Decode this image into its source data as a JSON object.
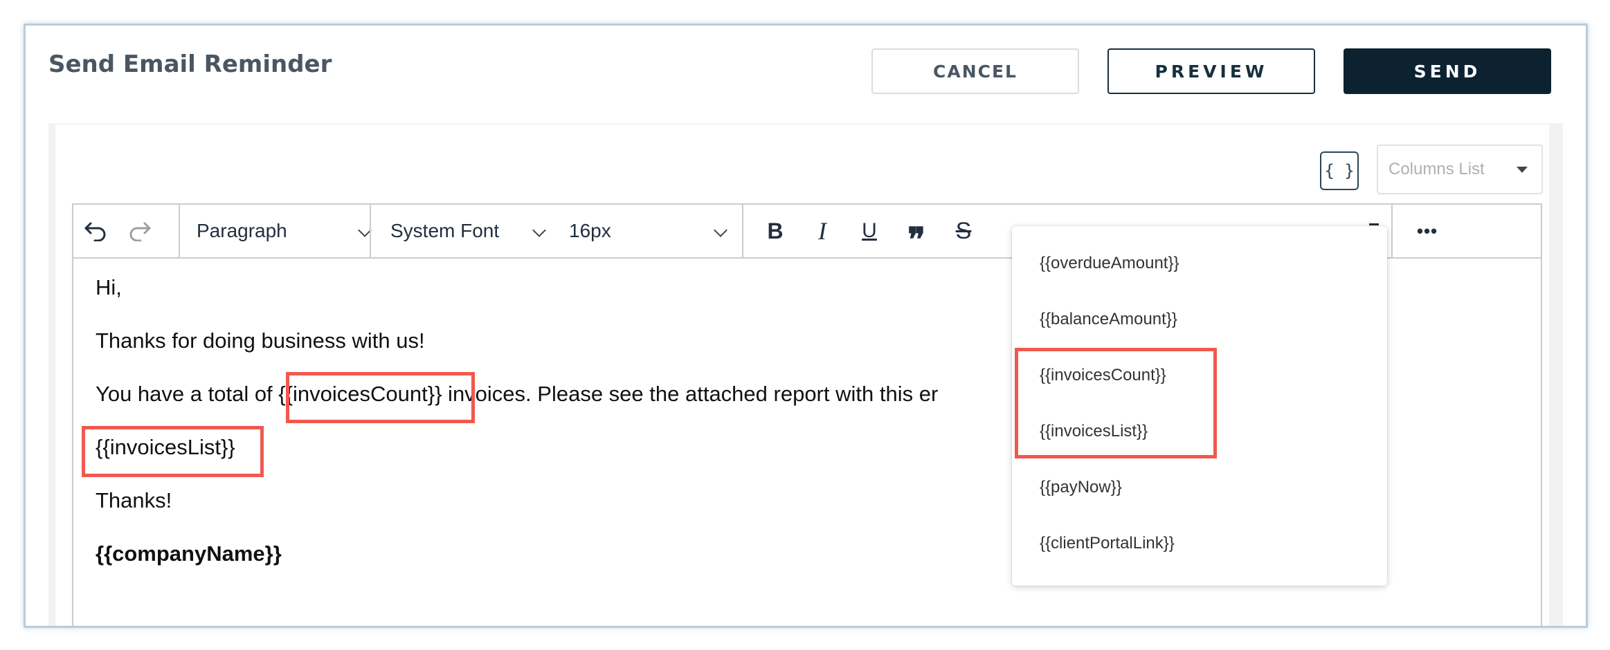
{
  "header": {
    "title": "Send Email Reminder",
    "cancel_label": "CANCEL",
    "preview_label": "PREVIEW",
    "send_label": "SEND"
  },
  "variables": {
    "button_label": "{ }",
    "columns_placeholder": "Columns List"
  },
  "toolbar": {
    "block_format": "Paragraph",
    "font_family": "System Font",
    "font_size": "16px",
    "bold_label": "B",
    "italic_label": "I",
    "underline_label": "U",
    "quote_label": "❞",
    "strike_label": "S",
    "more_label": "•••"
  },
  "email_body": {
    "greeting": "Hi,",
    "thanks_line": "Thanks for doing business with us!",
    "total_prefix": " You have a total of ",
    "invoices_count_var": "{{invoicesCount}}",
    "total_suffix": " invoices. Please see the attached report with this er",
    "invoices_list_var": "{{invoicesList}}",
    "closing": "Thanks!",
    "company_var": "{{companyName}}"
  },
  "dropdown": {
    "items": [
      "{{overdueAmount}}",
      "{{balanceAmount}}",
      "{{invoicesCount}}",
      "{{invoicesList}}",
      "{{payNow}}",
      "{{clientPortalLink}}"
    ]
  },
  "colors": {
    "primary_dark": "#0c2230",
    "highlight": "#f0594e",
    "frame_border": "#b9ccdc"
  }
}
